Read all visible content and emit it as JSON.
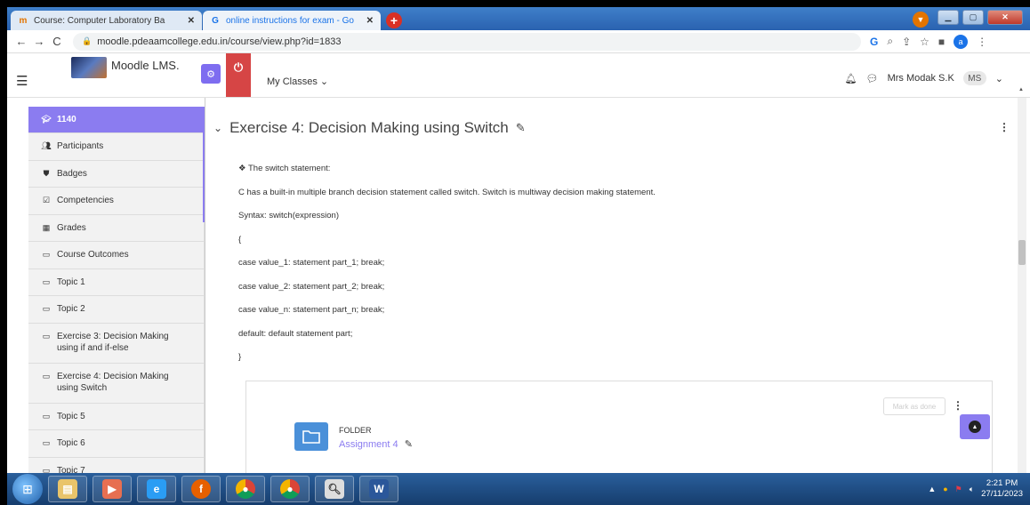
{
  "browser": {
    "tabs": [
      {
        "title": "Course: Computer Laboratory Ba",
        "icon": "moodle-tab-icon",
        "close": "✕"
      },
      {
        "title": "online instructions for exam - Go",
        "icon": "google-tab-icon",
        "close": "✕"
      }
    ],
    "new_tab": "+",
    "url": "moodle.pdeaamcollege.edu.in/course/view.php?id=1833",
    "profile_initial": "a"
  },
  "header": {
    "logo_text": "Moodle LMS.",
    "my_classes": "My Classes ⌄",
    "user_name": "Mrs Modak S.K",
    "user_initials": "MS"
  },
  "sidebar": {
    "course": "1140",
    "items": [
      {
        "label": "Participants",
        "icon": "users-icon"
      },
      {
        "label": "Badges",
        "icon": "badge-icon"
      },
      {
        "label": "Competencies",
        "icon": "checkbox-icon"
      },
      {
        "label": "Grades",
        "icon": "table-icon"
      },
      {
        "label": "Course Outcomes",
        "icon": "folder-outline-icon"
      },
      {
        "label": "Topic 1",
        "icon": "folder-outline-icon"
      },
      {
        "label": "Topic 2",
        "icon": "folder-outline-icon"
      },
      {
        "label": "Exercise 3: Decision Making using if and if-else",
        "icon": "folder-outline-icon"
      },
      {
        "label": "Exercise 4: Decision Making using Switch",
        "icon": "folder-outline-icon"
      },
      {
        "label": "Topic 5",
        "icon": "folder-outline-icon"
      },
      {
        "label": "Topic 6",
        "icon": "folder-outline-icon"
      },
      {
        "label": "Topic 7",
        "icon": "folder-outline-icon"
      }
    ]
  },
  "section": {
    "title": "Exercise 4: Decision Making using Switch",
    "lines": [
      "❖ The switch statement:",
      "C has a built-in multiple branch decision statement called switch. Switch is multiway decision making statement.",
      "Syntax: switch(expression)",
      "{",
      "case value_1: statement part_1; break;",
      "case value_2: statement part_2; break;",
      "case value_n: statement part_n; break;",
      "default: default statement part;",
      "}"
    ]
  },
  "activity": {
    "mark_done": "Mark as done",
    "type": "FOLDER",
    "name": "Assignment 4"
  },
  "taskbar": {
    "time": "2:21 PM",
    "date": "27/11/2023"
  },
  "colors": {
    "accent": "#8b7cf0",
    "power": "#d64545",
    "link": "#8b7cf0",
    "folder": "#4a90d9"
  }
}
